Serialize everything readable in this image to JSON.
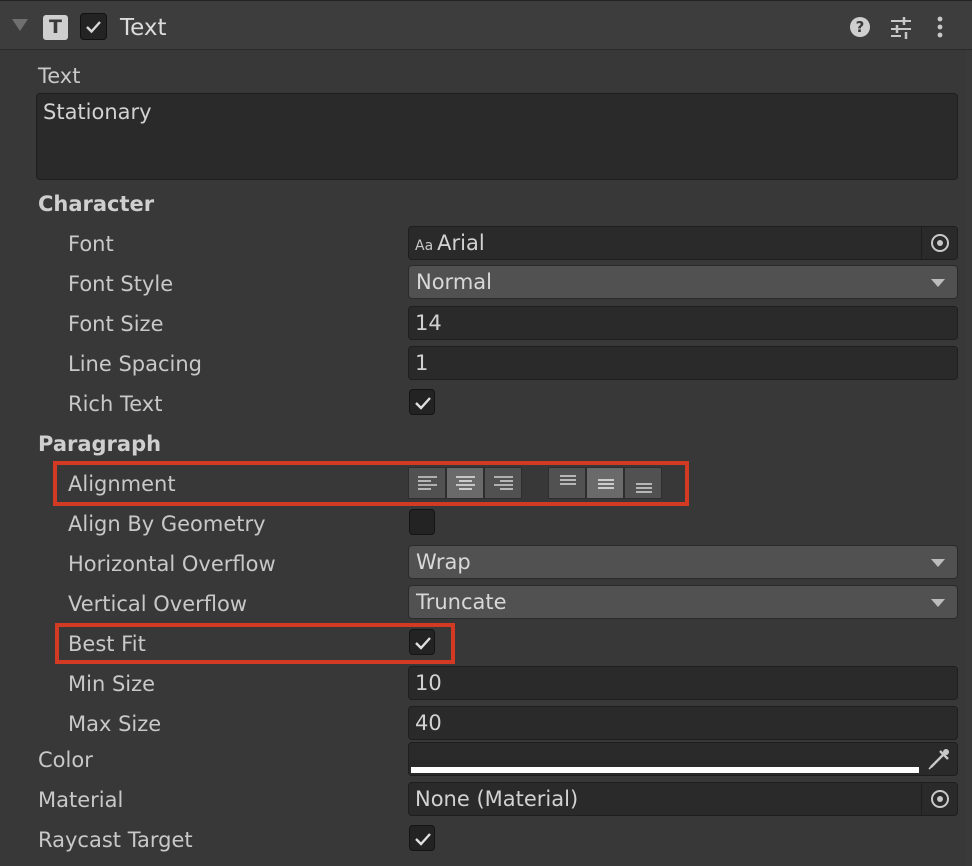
{
  "component": {
    "title": "Text",
    "enabled": true
  },
  "text": {
    "label": "Text",
    "value": "Stationary"
  },
  "character": {
    "header": "Character",
    "font": {
      "label": "Font",
      "value": "Arial",
      "icon": "Aa"
    },
    "font_style": {
      "label": "Font Style",
      "value": "Normal"
    },
    "font_size": {
      "label": "Font Size",
      "value": "14"
    },
    "line_spacing": {
      "label": "Line Spacing",
      "value": "1"
    },
    "rich_text": {
      "label": "Rich Text",
      "checked": true
    }
  },
  "paragraph": {
    "header": "Paragraph",
    "alignment": {
      "label": "Alignment",
      "horizontal": [
        "left",
        "center",
        "right"
      ],
      "vertical": [
        "upper",
        "middle",
        "lower"
      ],
      "selected_horizontal": "center",
      "selected_vertical": "middle"
    },
    "align_by_geometry": {
      "label": "Align By Geometry",
      "checked": false
    },
    "horizontal_overflow": {
      "label": "Horizontal Overflow",
      "value": "Wrap"
    },
    "vertical_overflow": {
      "label": "Vertical Overflow",
      "value": "Truncate"
    },
    "best_fit": {
      "label": "Best Fit",
      "checked": true
    },
    "min_size": {
      "label": "Min Size",
      "value": "10"
    },
    "max_size": {
      "label": "Max Size",
      "value": "40"
    }
  },
  "color": {
    "label": "Color",
    "value": "#ffffff"
  },
  "material": {
    "label": "Material",
    "value": "None (Material)"
  },
  "raycast_target": {
    "label": "Raycast Target",
    "checked": true
  },
  "colors": {
    "highlight": "#d23a24",
    "background": "#383838",
    "field": "#2a2a2a",
    "dropdown": "#515151"
  }
}
